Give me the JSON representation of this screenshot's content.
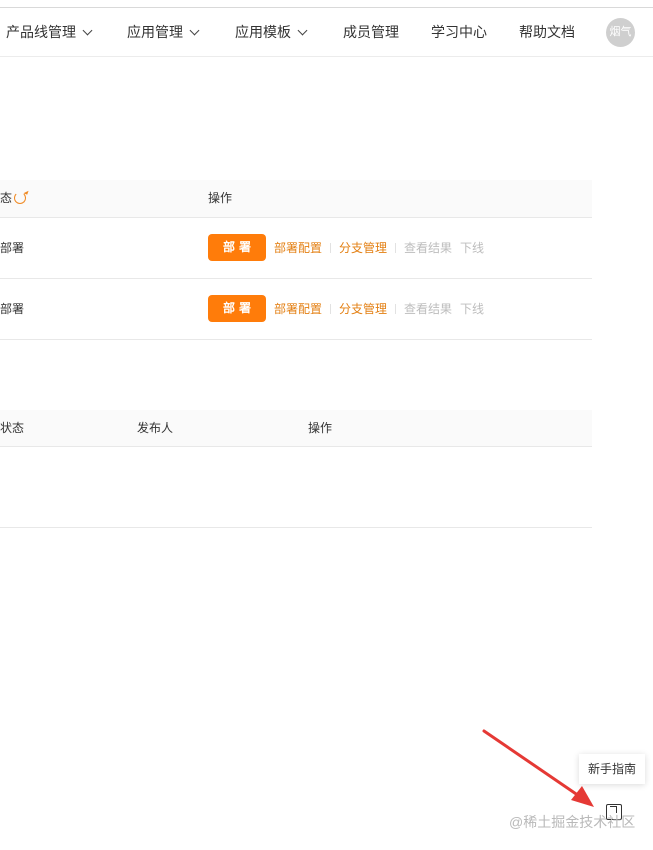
{
  "nav": {
    "items": [
      {
        "label": "产品线管理",
        "dropdown": true
      },
      {
        "label": "应用管理",
        "dropdown": true
      },
      {
        "label": "应用模板",
        "dropdown": true
      },
      {
        "label": "成员管理",
        "dropdown": false
      },
      {
        "label": "学习中心",
        "dropdown": false
      },
      {
        "label": "帮助文档",
        "dropdown": false
      }
    ],
    "avatar_text": "烟气"
  },
  "table1": {
    "headers": {
      "status": "态",
      "actions": "操作"
    },
    "rows": [
      {
        "status": "部署",
        "deploy": "部署",
        "actions": [
          "部署配置",
          "分支管理",
          "查看结果",
          "下线"
        ]
      },
      {
        "status": "部署",
        "deploy": "部署",
        "actions": [
          "部署配置",
          "分支管理",
          "查看结果",
          "下线"
        ]
      }
    ]
  },
  "table2": {
    "headers": {
      "status": "状态",
      "publisher": "发布人",
      "actions": "操作"
    }
  },
  "guide": {
    "tooltip": "新手指南",
    "icon": "send-icon"
  },
  "watermark": "@稀土掘金技术社区",
  "colors": {
    "accent": "#ff7c0a",
    "link": "#e37f12",
    "disabled": "#bdbdbd",
    "arrow": "#e53935"
  }
}
